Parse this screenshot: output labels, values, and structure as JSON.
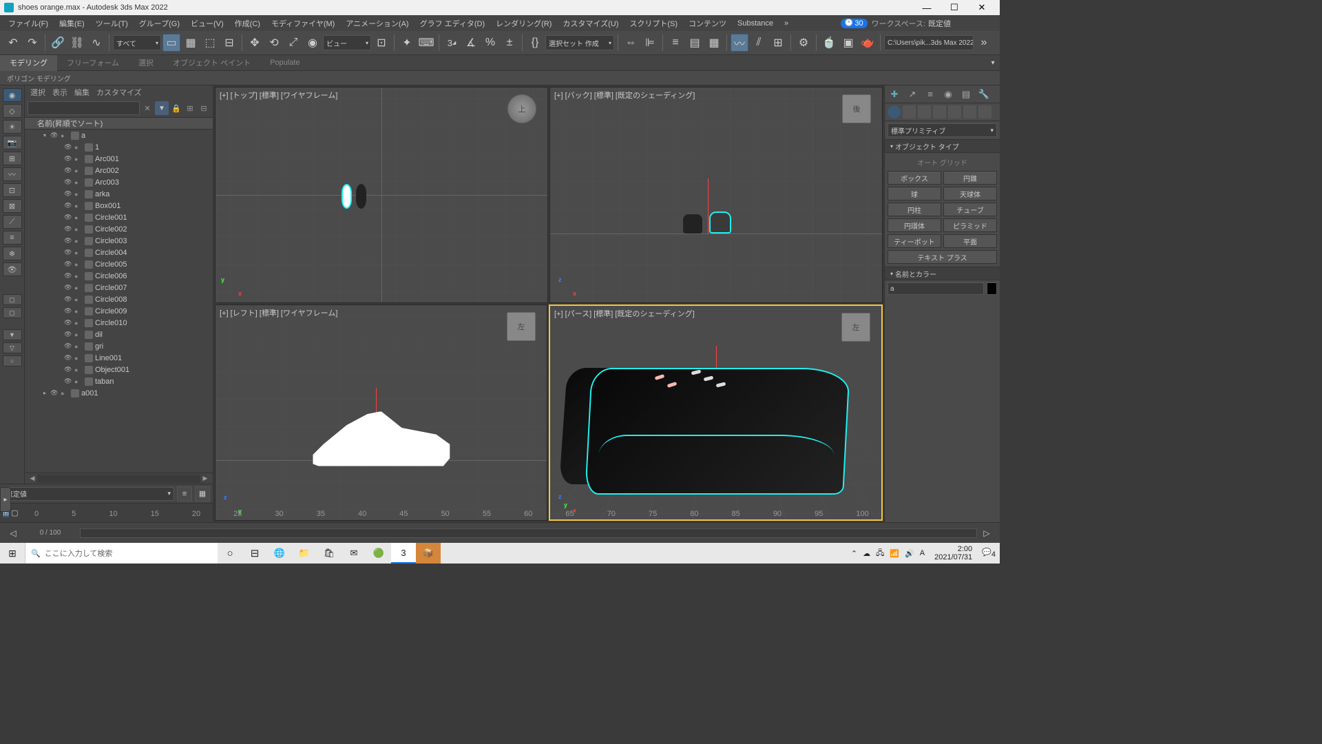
{
  "title": "shoes orange.max - Autodesk 3ds Max 2022",
  "menu": [
    "ファイル(F)",
    "編集(E)",
    "ツール(T)",
    "グループ(G)",
    "ビュー(V)",
    "作成(C)",
    "モディファイヤ(M)",
    "アニメーション(A)",
    "グラフ エディタ(D)",
    "レンダリング(R)",
    "カスタマイズ(U)",
    "スクリプト(S)",
    "コンテンツ",
    "Substance"
  ],
  "timer": "30",
  "workspace_label": "ワークスペース:",
  "workspace_value": "既定値",
  "toolbar": {
    "filter": "すべて",
    "view": "ビュー",
    "set": "選択セット 作成",
    "path": "C:\\Users\\pik...3ds Max 2022"
  },
  "ribbon_tabs": [
    "モデリング",
    "フリーフォーム",
    "選択",
    "オブジェクト ペイント",
    "Populate"
  ],
  "ribbon_sub": "ポリゴン モデリング",
  "scene": {
    "tabs": [
      "選択",
      "表示",
      "編集",
      "カスタマイズ"
    ],
    "header": "名前(昇順でソート)",
    "root": "a",
    "items": [
      "1",
      "Arc001",
      "Arc002",
      "Arc003",
      "arka",
      "Box001",
      "Circle001",
      "Circle002",
      "Circle003",
      "Circle004",
      "Circle005",
      "Circle006",
      "Circle007",
      "Circle008",
      "Circle009",
      "Circle010",
      "dil",
      "gri",
      "Line001",
      "Object001",
      "taban"
    ],
    "root2": "a001",
    "set": "既定値"
  },
  "viewports": {
    "tl": "[+] [トップ] [標準] [ワイヤフレーム]",
    "tr": "[+] [バック] [標準] [既定のシェーディング]",
    "bl": "[+] [レフト] [標準] [ワイヤフレーム]",
    "br": "[+] [パース] [標準] [既定のシェーディング]",
    "cube_top": "上",
    "cube_back": "後",
    "cube_left": "左",
    "cube_persp": "左"
  },
  "command_panel": {
    "category": "標準プリミティブ",
    "rollout1": "オブジェクト タイプ",
    "autogrid": "オート グリッド",
    "prims": [
      "ボックス",
      "円錐",
      "球",
      "天球体",
      "円柱",
      "チューブ",
      "円環体",
      "ピラミッド",
      "ティーポット",
      "平面",
      "テキスト プラス"
    ],
    "rollout2": "名前とカラー",
    "obj_name": "a"
  },
  "timeline": {
    "frame": "0 / 100",
    "ticks": [
      "0",
      "5",
      "10",
      "15",
      "20",
      "25",
      "30",
      "35",
      "40",
      "45",
      "50",
      "55",
      "60",
      "65",
      "70",
      "75",
      "80",
      "85",
      "90",
      "95",
      "100"
    ]
  },
  "taskbar": {
    "search": "ここに入力して検索",
    "time": "2:00",
    "date": "2021/07/31",
    "notif": "4"
  }
}
